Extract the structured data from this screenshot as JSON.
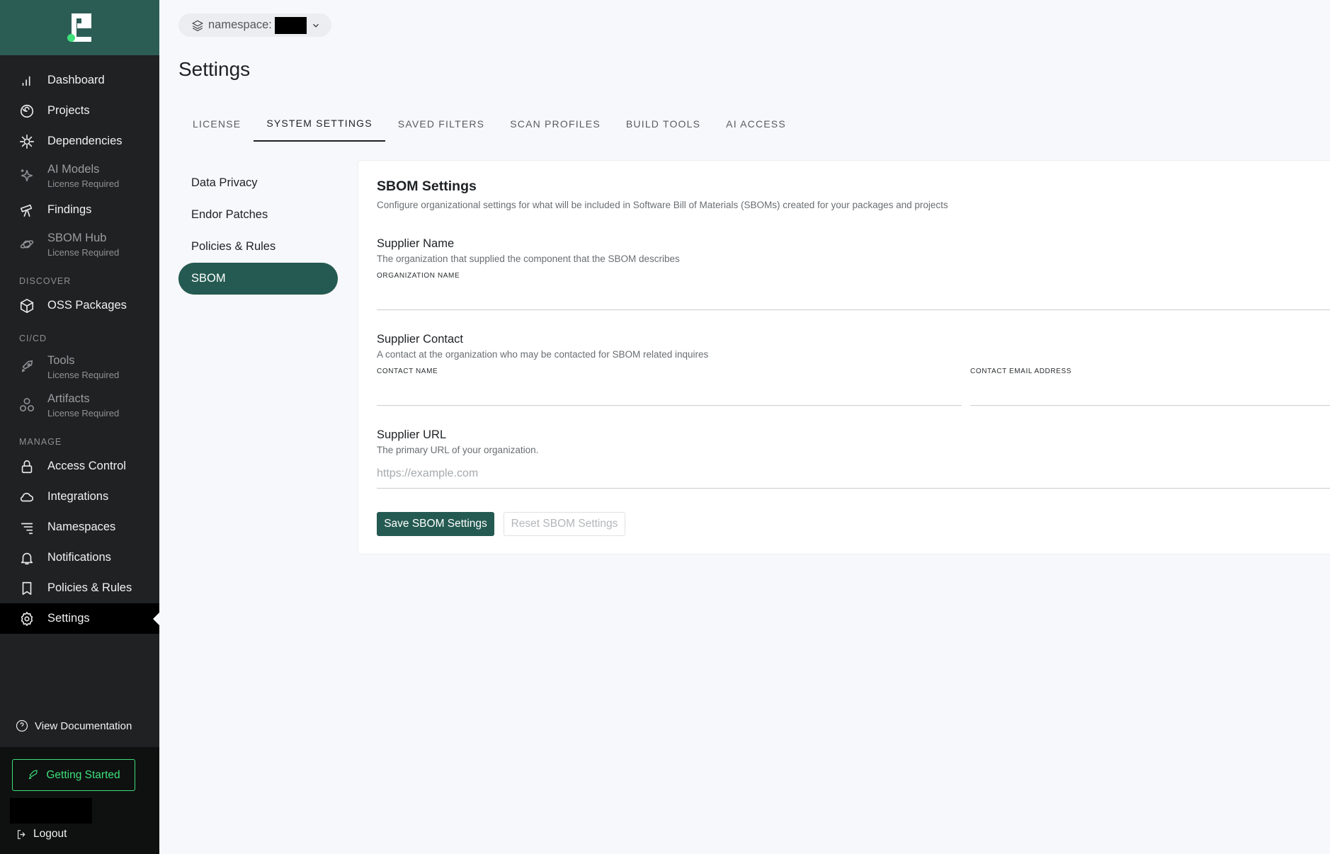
{
  "sidebar": {
    "items": [
      {
        "label": "Dashboard"
      },
      {
        "label": "Projects"
      },
      {
        "label": "Dependencies"
      },
      {
        "label": "AI Models",
        "sub": "License Required"
      },
      {
        "label": "Findings"
      },
      {
        "label": "SBOM Hub",
        "sub": "License Required"
      }
    ],
    "discover_label": "DISCOVER",
    "discover_items": [
      {
        "label": "OSS Packages"
      }
    ],
    "cicd_label": "CI/CD",
    "cicd_items": [
      {
        "label": "Tools",
        "sub": "License Required"
      },
      {
        "label": "Artifacts",
        "sub": "License Required"
      }
    ],
    "manage_label": "MANAGE",
    "manage_items": [
      {
        "label": "Access Control"
      },
      {
        "label": "Integrations"
      },
      {
        "label": "Namespaces"
      },
      {
        "label": "Notifications"
      },
      {
        "label": "Policies & Rules"
      },
      {
        "label": "Settings"
      }
    ],
    "view_docs": "View Documentation",
    "getting_started": "Getting Started",
    "logout": "Logout"
  },
  "namespace": {
    "label": "namespace:"
  },
  "page": {
    "title": "Settings"
  },
  "tabs": [
    "LICENSE",
    "SYSTEM SETTINGS",
    "SAVED FILTERS",
    "SCAN PROFILES",
    "BUILD TOOLS",
    "AI ACCESS"
  ],
  "active_tab": "SYSTEM SETTINGS",
  "subnav": [
    "Data Privacy",
    "Endor Patches",
    "Policies & Rules",
    "SBOM"
  ],
  "active_subnav": "SBOM",
  "sbom": {
    "title": "SBOM Settings",
    "description": "Configure organizational settings for what will be included in Software Bill of Materials (SBOMs) created for your packages and projects",
    "supplier_name": {
      "title": "Supplier Name",
      "description": "The organization that supplied the component that the SBOM describes",
      "input_label": "ORGANIZATION NAME",
      "value": ""
    },
    "supplier_contact": {
      "title": "Supplier Contact",
      "description": "A contact at the organization who may be contacted for SBOM related inquires",
      "name_label": "CONTACT NAME",
      "name_value": "",
      "email_label": "CONTACT EMAIL ADDRESS",
      "email_value": ""
    },
    "supplier_url": {
      "title": "Supplier URL",
      "description": "The primary URL of your organization.",
      "placeholder": "https://example.com",
      "value": ""
    },
    "save_label": "Save SBOM Settings",
    "reset_label": "Reset SBOM Settings"
  },
  "colors": {
    "brand": "#245a51",
    "accent_green": "#3ee07a",
    "sidebar_bg": "#1f2122"
  }
}
